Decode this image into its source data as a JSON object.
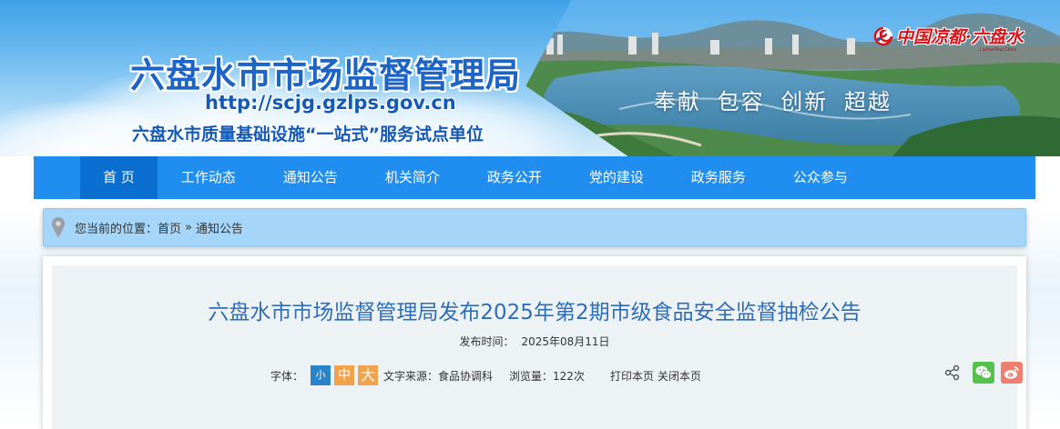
{
  "banner": {
    "site_title": "六盘水市市场监督管理局",
    "site_url": "http://scjg.gzlps.gov.cn",
    "subtitle": "六盘水市质量基础设施“一站式”服务试点单位",
    "slogan": "奉献 包容 创新 超越",
    "brand_logo_text": "中国凉都·六盘水",
    "brand_logo_sub": "LiuPanShui China",
    "logo_icon": "swirl-logo-icon"
  },
  "nav": {
    "items": [
      {
        "label": "首 页",
        "active": true
      },
      {
        "label": "工作动态",
        "active": false
      },
      {
        "label": "通知公告",
        "active": false
      },
      {
        "label": "机关简介",
        "active": false
      },
      {
        "label": "政务公开",
        "active": false
      },
      {
        "label": "党的建设",
        "active": false
      },
      {
        "label": "政务服务",
        "active": false
      },
      {
        "label": "公众参与",
        "active": false
      }
    ],
    "accent_color": "#1f8ef0",
    "active_color": "#0a6fd0"
  },
  "breadcrumb": {
    "icon": "location-pin-icon",
    "prefix": "您当前的位置：",
    "items": [
      "首页",
      "通知公告"
    ],
    "separator": "»"
  },
  "article": {
    "title": "六盘水市市场监督管理局发布2025年第2期市级食品安全监督抽检公告",
    "publish_label": "发布时间：",
    "publish_date": "2025年08月11日",
    "font_size_label": "字体：",
    "font_small": "小",
    "font_medium": "中",
    "font_large": "大",
    "source": "文字来源：食品协调科",
    "views": "浏览量：122次",
    "print": "打印本页",
    "close": "关闭本页",
    "share_icons": [
      "share-icon",
      "wechat-icon",
      "weibo-icon"
    ],
    "title_color": "#2f6db8"
  }
}
